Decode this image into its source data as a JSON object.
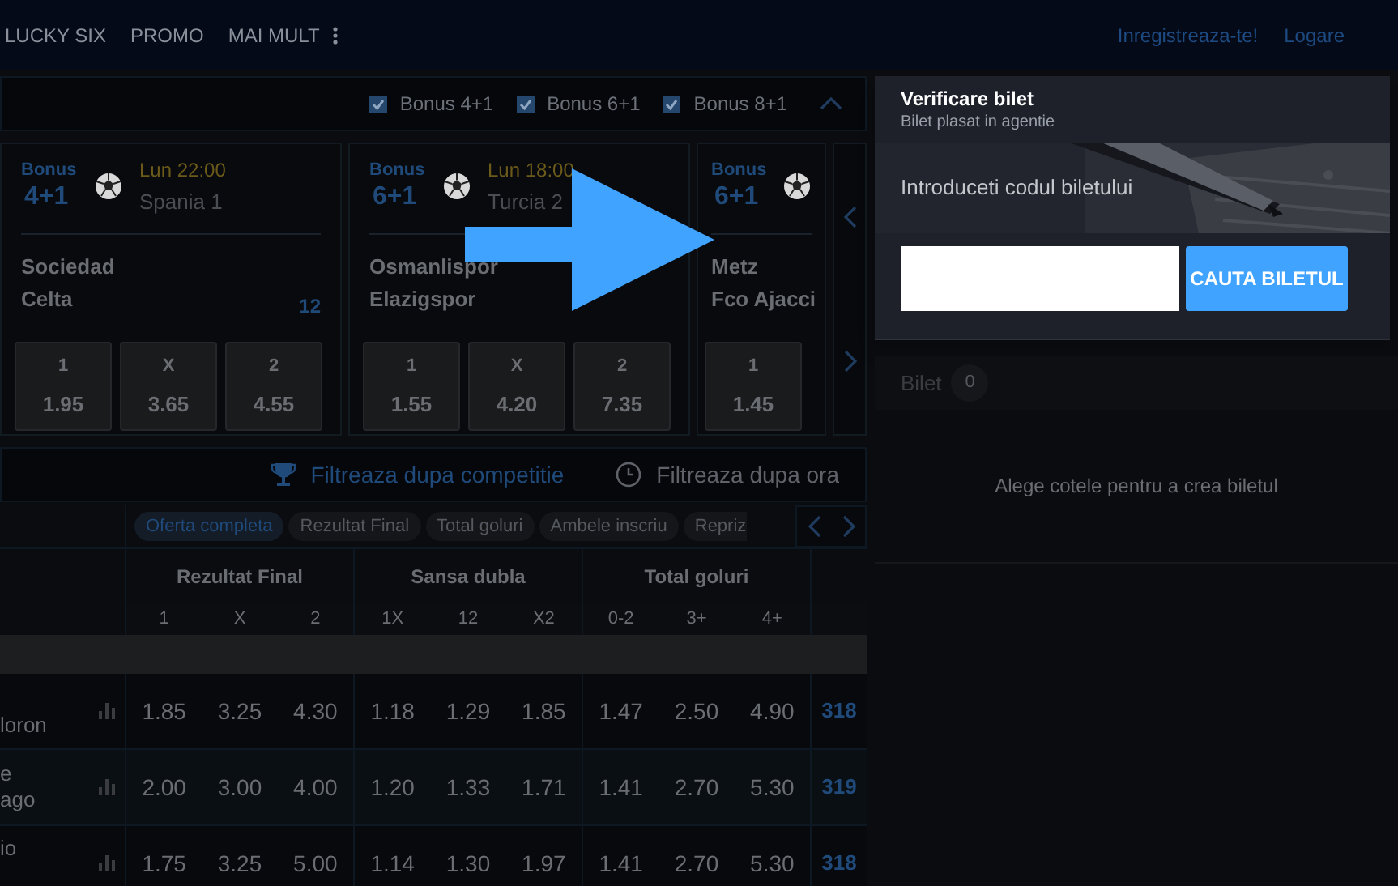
{
  "nav": {
    "items": [
      "LUCKY SIX",
      "PROMO",
      "MAI MULT"
    ],
    "register": "Inregistreaza-te!",
    "login": "Logare"
  },
  "bonus_filters": [
    {
      "label": "Bonus 4+1",
      "checked": true
    },
    {
      "label": "Bonus 6+1",
      "checked": true
    },
    {
      "label": "Bonus 8+1",
      "checked": true
    }
  ],
  "cards": [
    {
      "bonus": "Bonus",
      "bonus_value": "4+1",
      "time": "Lun 22:00",
      "league": "Spania 1",
      "teams": [
        "Sociedad",
        "Celta"
      ],
      "count": "12",
      "odds": [
        {
          "label": "1",
          "value": "1.95"
        },
        {
          "label": "X",
          "value": "3.65"
        },
        {
          "label": "2",
          "value": "4.55"
        }
      ]
    },
    {
      "bonus": "Bonus",
      "bonus_value": "6+1",
      "time": "Lun 18:00",
      "league": "Turcia 2",
      "teams": [
        "Osmanlispor",
        "Elazigspor"
      ],
      "odds": [
        {
          "label": "1",
          "value": "1.55"
        },
        {
          "label": "X",
          "value": "4.20"
        },
        {
          "label": "2",
          "value": "7.35"
        }
      ]
    },
    {
      "bonus": "Bonus",
      "bonus_value": "6+1",
      "teams": [
        "Metz",
        "Fco Ajacci"
      ],
      "odds": [
        {
          "label": "1",
          "value": "1.45"
        }
      ]
    }
  ],
  "filters": [
    {
      "label": "Filtreaza dupa competitie",
      "kind": "competition",
      "selected": true
    },
    {
      "label": "Filtreaza dupa ora",
      "kind": "time",
      "selected": false
    }
  ],
  "market_tabs": [
    {
      "label": "Oferta completa",
      "selected": true
    },
    {
      "label": "Rezultat Final",
      "selected": false
    },
    {
      "label": "Total goluri",
      "selected": false
    },
    {
      "label": "Ambele inscriu",
      "selected": false
    },
    {
      "label": "Repriz",
      "selected": false
    }
  ],
  "table": {
    "groups": [
      {
        "title": "Rezultat Final",
        "columns": [
          "1",
          "X",
          "2"
        ]
      },
      {
        "title": "Sansa dubla",
        "columns": [
          "1X",
          "12",
          "X2"
        ]
      },
      {
        "title": "Total goluri",
        "columns": [
          "0-2",
          "3+",
          "4+"
        ]
      }
    ],
    "rows": [
      {
        "team_lines": [
          "loron"
        ],
        "odds": [
          "1.85",
          "3.25",
          "4.30",
          "1.18",
          "1.29",
          "1.85",
          "1.47",
          "2.50",
          "4.90"
        ],
        "code": "318"
      },
      {
        "team_lines": [
          "e",
          "ago"
        ],
        "odds": [
          "2.00",
          "3.00",
          "4.00",
          "1.20",
          "1.33",
          "1.71",
          "1.41",
          "2.70",
          "5.30"
        ],
        "code": "319"
      },
      {
        "team_lines": [
          "io"
        ],
        "odds": [
          "1.75",
          "3.25",
          "5.00",
          "1.14",
          "1.30",
          "1.97",
          "1.41",
          "2.70",
          "5.30"
        ],
        "code": "318"
      }
    ]
  },
  "ticket_check": {
    "title": "Verificare bilet",
    "subtitle": "Bilet plasat in agentie",
    "prompt": "Introduceti codul biletului",
    "button": "CAUTA BILETUL"
  },
  "bet_slip": {
    "title": "Bilet",
    "count": "0",
    "empty_message": "Alege cotele pentru a crea biletul"
  }
}
